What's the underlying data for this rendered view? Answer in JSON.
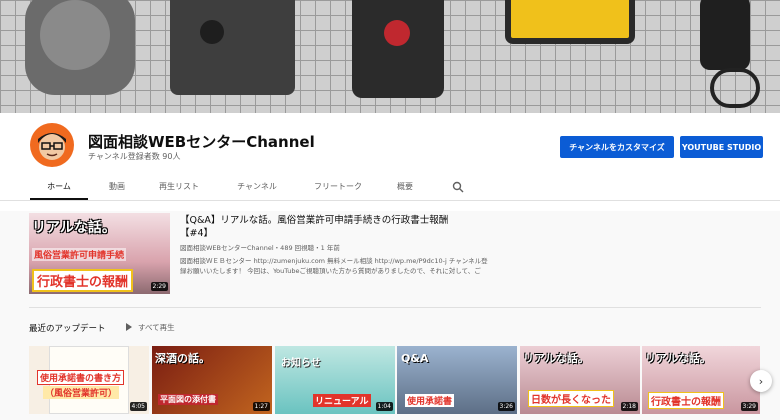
{
  "channel": {
    "title": "図面相談WEBセンターChannel",
    "subscribers": "チャンネル登録者数 90人"
  },
  "buttons": {
    "customize": "チャンネルをカスタマイズ",
    "studio": "YOUTUBE STUDIO"
  },
  "tabs": [
    {
      "label": "ホーム",
      "active": true
    },
    {
      "label": "動画"
    },
    {
      "label": "再生リスト"
    },
    {
      "label": "チャンネル"
    },
    {
      "label": "フリートーク"
    },
    {
      "label": "概要"
    }
  ],
  "featured": {
    "title_line1": "【Q&A】リアルな話。風俗営業許可申請手続きの行政書士報酬",
    "title_line2": "【#4】",
    "meta": "図面相談WEBセンターChannel・489 回視聴・1 年前",
    "desc_line1": "図面相談ＷＥＢセンター http://zumenjuku.com 無料メール相談 http://wp.me/P9dc10-j チャンネル登",
    "desc_line2": "録お願いいたします！ 今回は、YouTubeご視聴頂いた方から質問がありましたので、それに対して、ご",
    "thumb_text_top": "リアルな話。",
    "thumb_text_mid": "風俗営業許可申請手続",
    "thumb_text_bottom": "行政書士の報酬",
    "duration": "2:29"
  },
  "section": {
    "title": "最近のアップデート",
    "play_all": "すべて再生"
  },
  "videos": [
    {
      "line1": "使用承諾書の書き方",
      "line2": "（風俗営業許可）",
      "duration": "4:05"
    },
    {
      "line1": "深酒の話。",
      "line2": "平面図の添付書",
      "duration": "1:27"
    },
    {
      "line1": "お知らせ",
      "line2": "リニューアル",
      "duration": "1:04"
    },
    {
      "line1": "Q&A",
      "line2": "使用承諾書",
      "duration": "3:26"
    },
    {
      "line1": "リアルな話。",
      "line2": "日数が長くなった",
      "duration": "2:18"
    },
    {
      "line1": "リアルな話。",
      "line2": "行政書士の報酬",
      "duration": "3:29"
    }
  ],
  "icons": {
    "search": "search-icon",
    "next": "chevron-right-icon",
    "play": "play-icon"
  },
  "colors": {
    "accent": "#0b5cd5",
    "avatar_bg": "#f06a1f"
  }
}
